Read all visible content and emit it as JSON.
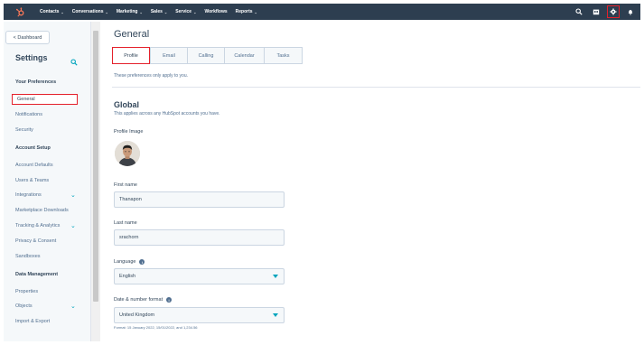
{
  "topnav": {
    "items": [
      "Contacts",
      "Conversations",
      "Marketing",
      "Sales",
      "Service",
      "Workflows",
      "Reports"
    ],
    "has_caret": [
      true,
      true,
      true,
      true,
      true,
      false,
      true
    ]
  },
  "sidebar": {
    "dashboard_label": "< Dashboard",
    "title": "Settings",
    "sections": {
      "preferences": "Your Preferences",
      "account_setup": "Account Setup",
      "data_management": "Data Management"
    },
    "items": {
      "general": "General",
      "notifications": "Notifications",
      "security": "Security",
      "account_defaults": "Account Defaults",
      "users_teams": "Users & Teams",
      "integrations": "Integrations",
      "marketplace": "Marketplace Downloads",
      "tracking": "Tracking & Analytics",
      "privacy": "Privacy & Consent",
      "sandboxes": "Sandboxes",
      "properties": "Properties",
      "objects": "Objects",
      "import_export": "Import & Export"
    }
  },
  "main": {
    "title": "General",
    "tabs": [
      "Profile",
      "Email",
      "Calling",
      "Calendar",
      "Tasks"
    ],
    "active_tab": "Profile",
    "intro": "These preferences only apply to you.",
    "global_title": "Global",
    "global_desc": "This applies across any HubSpot accounts you have.",
    "profile_image_label": "Profile Image",
    "first_name_label": "First name",
    "first_name_value": "Thanapon",
    "last_name_label": "Last name",
    "last_name_value": "srachorn",
    "language_label": "Language",
    "language_value": "English",
    "date_format_label": "Date & number format",
    "date_format_value": "United Kingdom",
    "format_hint": "Format: 15 January 2022, 15/01/2022, and 1,234.56"
  },
  "colors": {
    "nav_bg": "#2d3e50",
    "accent": "#00a4bd",
    "highlight": "#e4202b",
    "hubspot_orange": "#ff7a59"
  }
}
